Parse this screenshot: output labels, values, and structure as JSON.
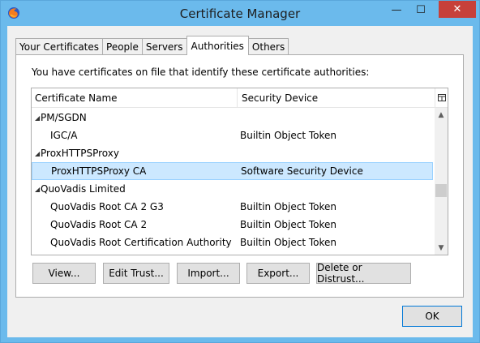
{
  "window": {
    "title": "Certificate Manager",
    "close_glyph": "✕",
    "minimize_glyph": "—",
    "maximize_glyph": "☐"
  },
  "tabs": [
    {
      "label": "Your Certificates",
      "active": false
    },
    {
      "label": "People",
      "active": false
    },
    {
      "label": "Servers",
      "active": false
    },
    {
      "label": "Authorities",
      "active": true
    },
    {
      "label": "Others",
      "active": false
    }
  ],
  "panel": {
    "intro_text": "You have certificates on file that identify these certificate authorities:"
  },
  "tree": {
    "columns": {
      "name": "Certificate Name",
      "device": "Security Device"
    },
    "rows": [
      {
        "type": "group",
        "name": "PM/SGDN",
        "device": ""
      },
      {
        "type": "cert",
        "name": "IGC/A",
        "device": "Builtin Object Token",
        "selected": false
      },
      {
        "type": "group",
        "name": "ProxHTTPSProxy",
        "device": ""
      },
      {
        "type": "cert",
        "name": "ProxHTTPSProxy CA",
        "device": "Software Security Device",
        "selected": true
      },
      {
        "type": "group",
        "name": "QuoVadis Limited",
        "device": ""
      },
      {
        "type": "cert",
        "name": "QuoVadis Root CA 2 G3",
        "device": "Builtin Object Token",
        "selected": false
      },
      {
        "type": "cert",
        "name": "QuoVadis Root CA 2",
        "device": "Builtin Object Token",
        "selected": false
      },
      {
        "type": "cert",
        "name": "QuoVadis Root Certification Authority",
        "device": "Builtin Object Token",
        "selected": false
      }
    ]
  },
  "buttons": {
    "view": "View...",
    "edit_trust": "Edit Trust...",
    "import": "Import...",
    "export": "Export...",
    "delete": "Delete or Distrust...",
    "ok": "OK"
  },
  "colors": {
    "title_bar": "#6bbaec",
    "close_button": "#c7403a",
    "selected_row": "#cce8ff"
  }
}
